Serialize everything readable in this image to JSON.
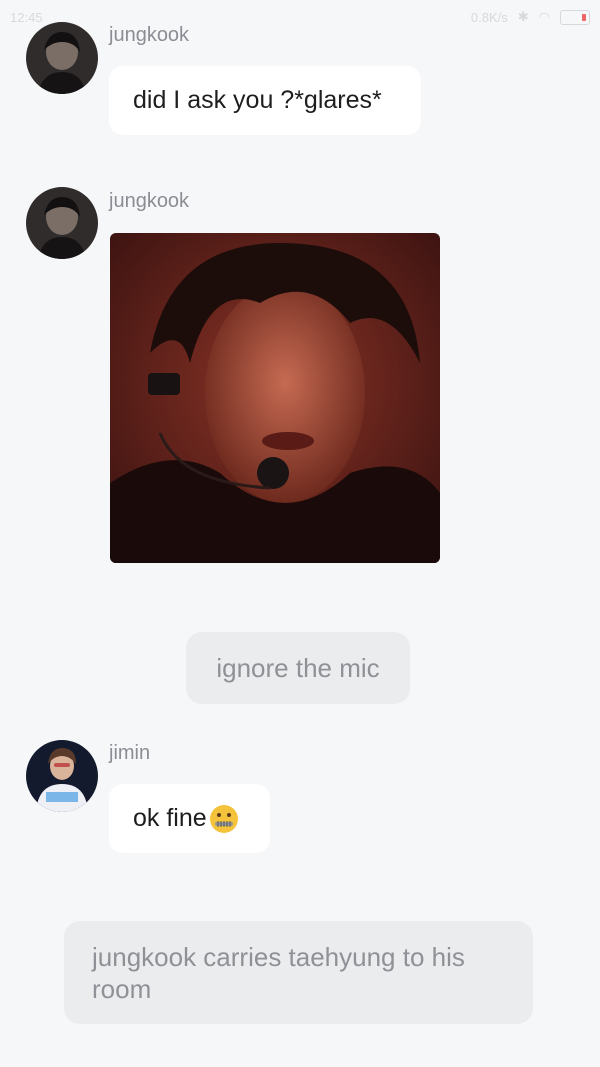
{
  "status_bar": {
    "time": "12:45",
    "network": "0.8K/s"
  },
  "messages": [
    {
      "sender": "jungkook",
      "text": "did I ask you ?*glares*"
    },
    {
      "sender": "jungkook",
      "image": "photo-message"
    },
    {
      "narration": "ignore the mic"
    },
    {
      "sender": "jimin",
      "text": "ok fine",
      "emoji": "zipper-mouth-face-icon"
    },
    {
      "narration": "jungkook carries taehyung to his room"
    }
  ]
}
